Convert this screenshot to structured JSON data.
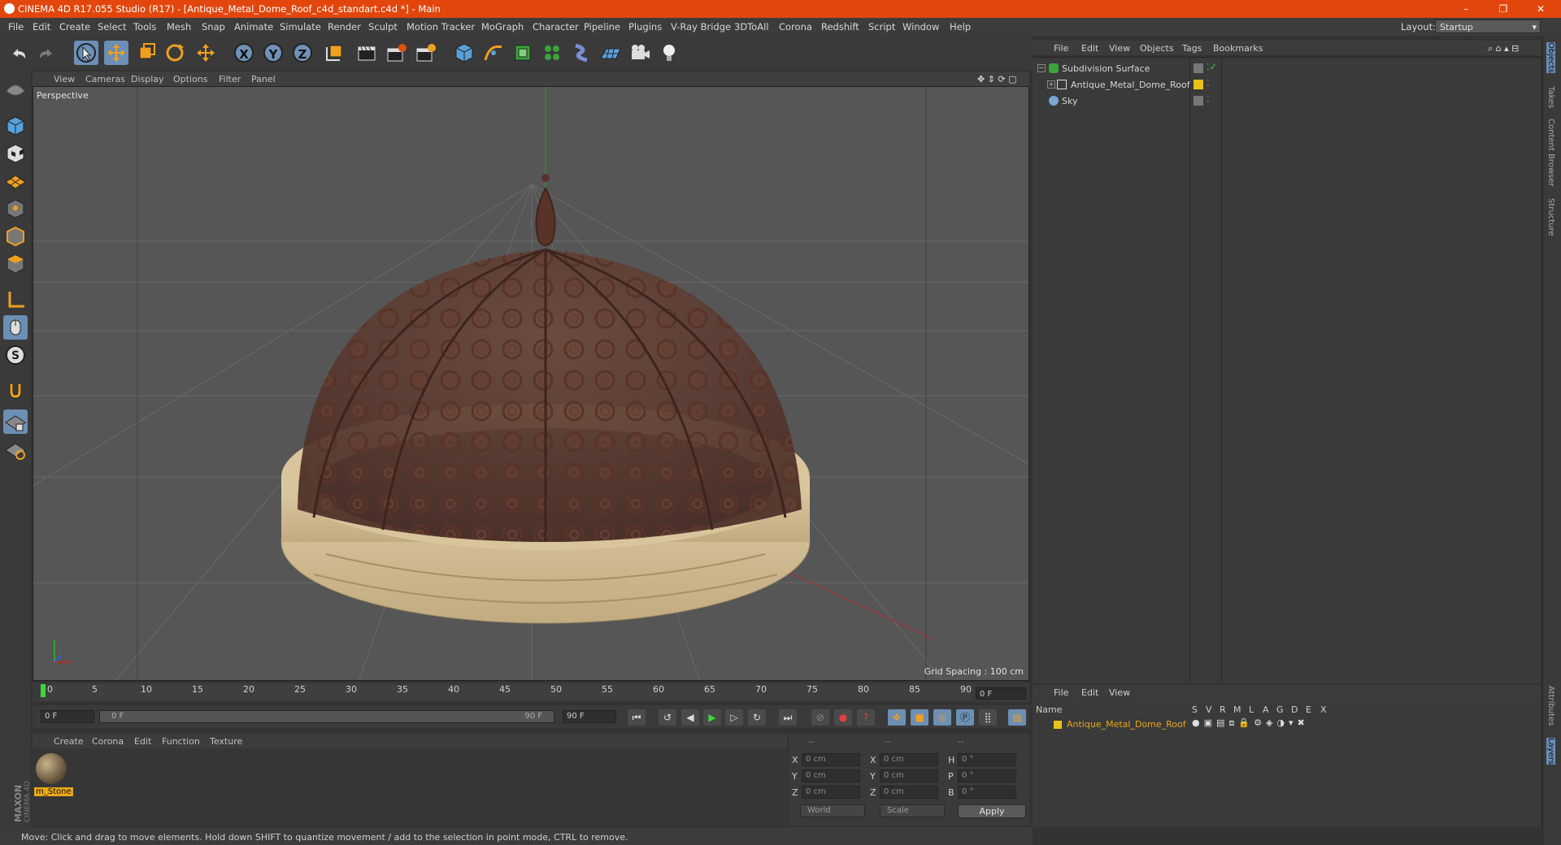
{
  "window": {
    "title": "CINEMA 4D R17.055 Studio (R17) - [Antique_Metal_Dome_Roof_c4d_standart.c4d *] - Main",
    "controls": [
      "–",
      "❐",
      "✕"
    ]
  },
  "menubar": {
    "items": [
      "File",
      "Edit",
      "Create",
      "Select",
      "Tools",
      "Mesh",
      "Snap",
      "Animate",
      "Simulate",
      "Render",
      "Sculpt",
      "Motion Tracker",
      "MoGraph",
      "Character",
      "Pipeline",
      "Plugins",
      "V-Ray Bridge",
      "3DToAll",
      "Corona",
      "Redshift",
      "Script",
      "Window",
      "Help"
    ],
    "layout_label": "Layout:",
    "layout_value": "Startup"
  },
  "toolbar": {
    "axis_buttons": [
      "X",
      "Y",
      "Z"
    ]
  },
  "viewport": {
    "menu": [
      "View",
      "Cameras",
      "Display",
      "Options",
      "Filter",
      "Panel"
    ],
    "camera_label": "Perspective",
    "grid_spacing": "Grid Spacing : 100 cm"
  },
  "timeline": {
    "ticks": [
      "0",
      "5",
      "10",
      "15",
      "20",
      "25",
      "30",
      "35",
      "40",
      "45",
      "50",
      "55",
      "60",
      "65",
      "70",
      "75",
      "80",
      "85",
      "90"
    ],
    "current_frame_field": "0 F",
    "start_field": "0 F",
    "range_start": "0 F",
    "range_end": "90 F",
    "end_field": "90 F"
  },
  "material_manager": {
    "menu": [
      "Create",
      "Corona",
      "Edit",
      "Function",
      "Texture"
    ],
    "materials": [
      {
        "name": "m_Stone"
      }
    ]
  },
  "coordinates": {
    "headers": [
      "--",
      "--",
      "--"
    ],
    "rows": [
      {
        "label1": "X",
        "val1": "0 cm",
        "label2": "X",
        "val2": "0 cm",
        "label3": "H",
        "val3": "0 °"
      },
      {
        "label1": "Y",
        "val1": "0 cm",
        "label2": "Y",
        "val2": "0 cm",
        "label3": "P",
        "val3": "0 °"
      },
      {
        "label1": "Z",
        "val1": "0 cm",
        "label2": "Z",
        "val2": "0 cm",
        "label3": "B",
        "val3": "0 °"
      }
    ],
    "dropdown1": "World",
    "dropdown2": "Scale",
    "apply": "Apply"
  },
  "status": {
    "text": "Move: Click and drag to move elements. Hold down SHIFT to quantize movement / add to the selection in point mode, CTRL to remove."
  },
  "object_manager": {
    "menu": [
      "File",
      "Edit",
      "View",
      "Objects",
      "Tags",
      "Bookmarks"
    ],
    "objects": [
      {
        "name": "Subdivision Surface",
        "indent": 0,
        "icon_color": "#3aa43a"
      },
      {
        "name": "Antique_Metal_Dome_Roof",
        "indent": 1,
        "icon_color": "#cfcfcf"
      },
      {
        "name": "Sky",
        "indent": 0,
        "icon_color": "#7aa6d6"
      }
    ]
  },
  "layer_manager": {
    "menu": [
      "File",
      "Edit",
      "View"
    ],
    "columns": [
      "Name",
      "S",
      "V",
      "R",
      "M",
      "L",
      "A",
      "G",
      "D",
      "E",
      "X"
    ],
    "layers": [
      {
        "name": "Antique_Metal_Dome_Roof",
        "color": "#e8c21a"
      }
    ]
  },
  "right_tabs": [
    "Objects",
    "Takes",
    "Content Browser",
    "Structure",
    "Attributes",
    "Layers"
  ],
  "branding": {
    "logo_text": "MAXON CINEMA 4D"
  },
  "colors": {
    "accent": "#e2460c",
    "highlight": "#e8a81a"
  }
}
